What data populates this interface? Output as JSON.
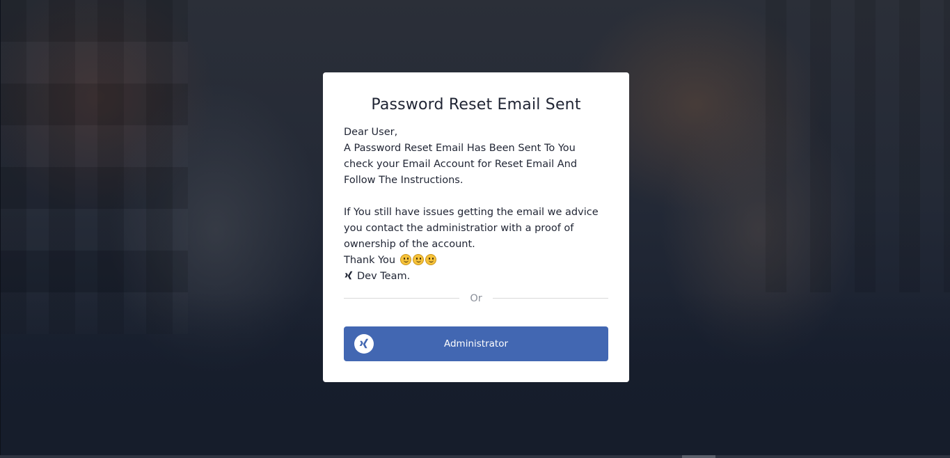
{
  "card": {
    "title": "Password Reset Email Sent",
    "message_lines": [
      "Dear User,",
      "A Password Reset Email Has Been Sent To You",
      "check your Email Account for Reset Email And",
      "Follow The Instructions.",
      "If You still have issues getting the email we advice",
      "you contact the administratior with a proof of",
      "ownership of the account."
    ],
    "thank_you": "Thank You",
    "signature": "Dev Team.",
    "divider_text": "Or",
    "admin_button_label": "Administrator"
  },
  "icons": {
    "smiley": "slightly-smiling-face-emoji",
    "xing": "xing-logo-icon"
  },
  "colors": {
    "button_bg": "#4267b2",
    "card_bg": "#ffffff",
    "text": "#1f2433",
    "background": "#1b2232"
  }
}
